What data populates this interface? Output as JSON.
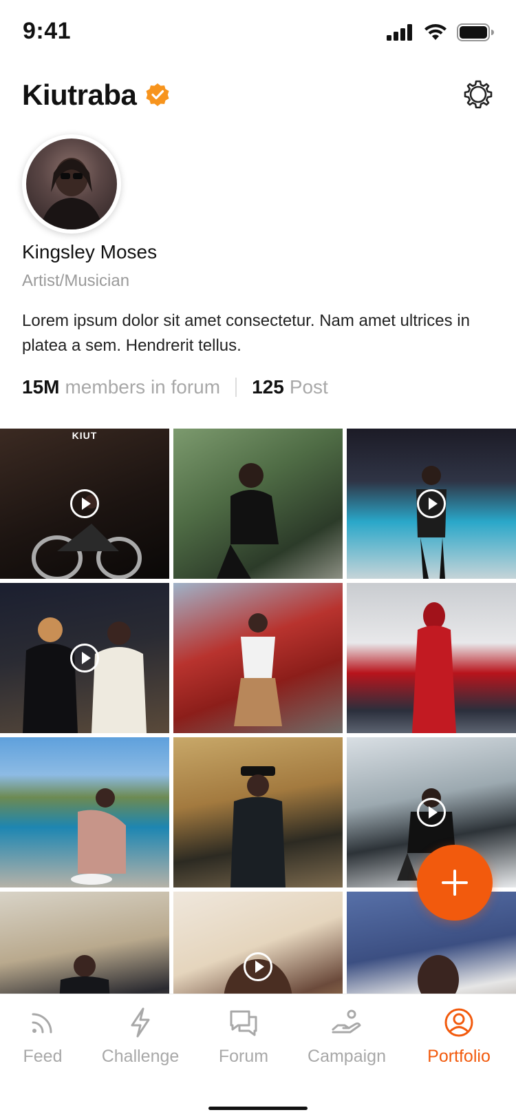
{
  "status_bar": {
    "time": "9:41"
  },
  "header": {
    "handle": "Kiutraba",
    "verified_color": "#f7941d"
  },
  "profile": {
    "name": "Kingsley Moses",
    "role": "Artist/Musician",
    "bio": "Lorem ipsum dolor sit amet consectetur. Nam amet ultrices in platea a sem. Hendrerit tellus.",
    "stats": {
      "members_value": "15M",
      "members_label": "members in forum",
      "posts_value": "125",
      "posts_label": "Post"
    }
  },
  "grid": {
    "tiles": [
      {
        "type": "video",
        "label": "KIUT"
      },
      {
        "type": "photo"
      },
      {
        "type": "video"
      },
      {
        "type": "video"
      },
      {
        "type": "photo"
      },
      {
        "type": "photo"
      },
      {
        "type": "photo"
      },
      {
        "type": "photo"
      },
      {
        "type": "video"
      },
      {
        "type": "photo"
      },
      {
        "type": "video"
      },
      {
        "type": "photo"
      }
    ]
  },
  "fab": {
    "icon": "plus-icon",
    "color": "#f25a0d"
  },
  "bottom_nav": {
    "items": [
      {
        "label": "Feed",
        "icon": "rss-icon"
      },
      {
        "label": "Challenge",
        "icon": "bolt-icon"
      },
      {
        "label": "Forum",
        "icon": "chat-bubbles-icon"
      },
      {
        "label": "Campaign",
        "icon": "hand-coin-icon"
      },
      {
        "label": "Portfolio",
        "icon": "user-circle-icon",
        "active": true
      }
    ],
    "active_color": "#f25a0d",
    "inactive_color": "#a8a8a8"
  }
}
